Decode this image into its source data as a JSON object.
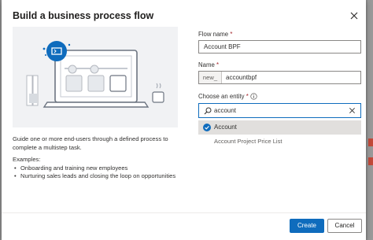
{
  "dialog": {
    "title": "Build a business process flow",
    "description": "Guide one or more end-users through a defined process to complete a multistep task.",
    "examples_heading": "Examples:",
    "examples": [
      "Onboarding and training new employees",
      "Nurturing sales leads and closing the loop on opportunities"
    ]
  },
  "form": {
    "flow_name": {
      "label": "Flow name",
      "required_mark": "*",
      "value": "Account BPF"
    },
    "name": {
      "label": "Name",
      "required_mark": "*",
      "prefix": "new_",
      "value": "accountbpf"
    },
    "entity": {
      "label": "Choose an entity",
      "required_mark": "*",
      "search_value": "account",
      "options": [
        {
          "label": "Account",
          "selected": true
        },
        {
          "label": "Account Project Price List",
          "selected": false
        }
      ]
    }
  },
  "buttons": {
    "create": "Create",
    "cancel": "Cancel"
  },
  "colors": {
    "accent": "#0f6cbd",
    "selected_row": "#e1dfdd",
    "required": "#a4262c"
  }
}
